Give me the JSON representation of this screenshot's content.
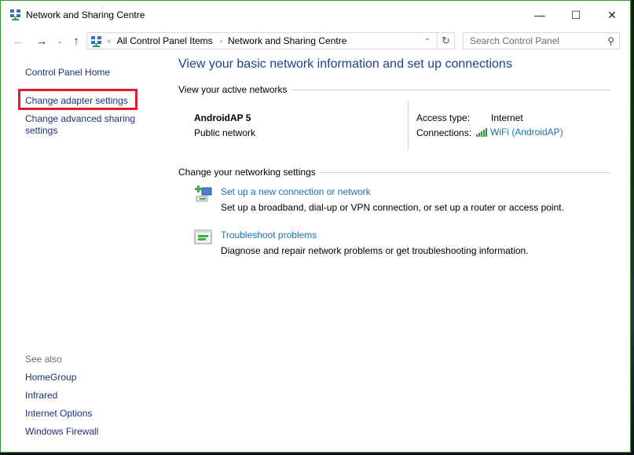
{
  "window": {
    "title": "Network and Sharing Centre",
    "icon": "network-sharing-icon",
    "controls": {
      "minimize": "—",
      "maximize": "☐",
      "close": "✕"
    }
  },
  "navbar": {
    "back": "←",
    "forward": "→",
    "recent": "⌄",
    "up": "↑",
    "address": {
      "overflow": "«",
      "segments": [
        "All Control Panel Items",
        "Network and Sharing Centre"
      ],
      "separator": "›",
      "dropdown": "⌄",
      "refresh": "↻"
    },
    "search": {
      "placeholder": "Search Control Panel",
      "icon": "⚲"
    }
  },
  "left_pane": {
    "home": "Control Panel Home",
    "tasks": [
      "Change adapter settings",
      "Change advanced sharing settings"
    ],
    "highlighted_task": "Change adapter settings",
    "see_also_label": "See also",
    "see_also": [
      "HomeGroup",
      "Infrared",
      "Internet Options",
      "Windows Firewall"
    ]
  },
  "main": {
    "heading": "View your basic network information and set up connections",
    "active_networks": {
      "title": "View your active networks",
      "network_name": "AndroidAP  5",
      "network_type": "Public network",
      "access_type_label": "Access type:",
      "access_type_value": "Internet",
      "connections_label": "Connections:",
      "connection_value": "WiFi (AndroidAP)",
      "signal_bars": 5,
      "signal_bars_total": 5
    },
    "change_settings": {
      "title": "Change your networking settings",
      "tasks": [
        {
          "link": "Set up a new connection or network",
          "desc": "Set up a broadband, dial-up or VPN connection, or set up a router or access point.",
          "icon": "new-connection-icon"
        },
        {
          "link": "Troubleshoot problems",
          "desc": "Diagnose and repair network problems or get troubleshooting information.",
          "icon": "troubleshoot-icon"
        }
      ]
    }
  },
  "colors": {
    "link_dark": "#1a3187",
    "link_blue": "#1c6fc4",
    "heading": "#1e3f9a",
    "highlight_box": "#e8192c",
    "window_border": "#2d9a2d",
    "signal": "#2e9a3a"
  }
}
